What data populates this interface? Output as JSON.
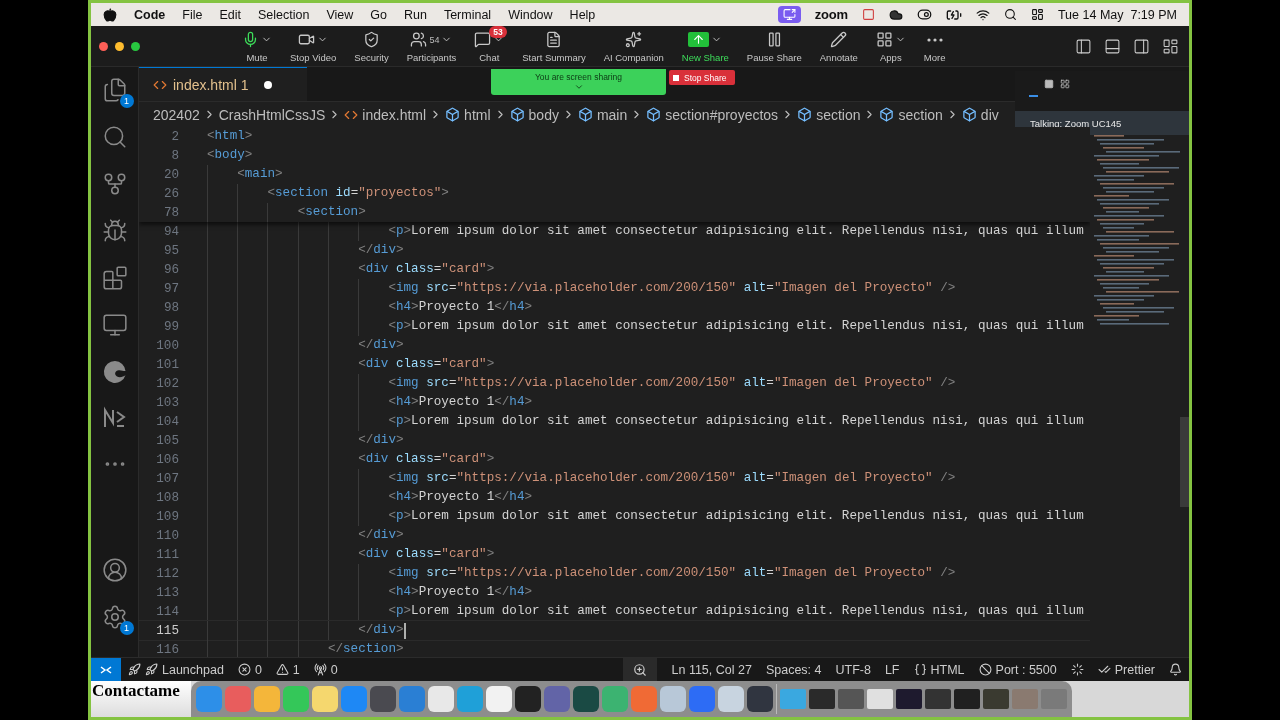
{
  "menu_bar": {
    "app": "Code",
    "items": [
      "File",
      "Edit",
      "Selection",
      "View",
      "Go",
      "Run",
      "Terminal",
      "Window",
      "Help"
    ],
    "app_label": "zoom",
    "datetime": "Tue 14 May  7:19 PM"
  },
  "zoom_toolbar": {
    "items": [
      {
        "kind": "mic",
        "label": "Mute",
        "caret": true,
        "active": true
      },
      {
        "kind": "video",
        "label": "Stop Video",
        "caret": true,
        "active": false
      },
      {
        "kind": "security",
        "label": "Security",
        "caret": false,
        "active": false
      },
      {
        "kind": "participants",
        "label": "Participants",
        "count": "54",
        "caret": true,
        "active": false
      },
      {
        "kind": "chat",
        "label": "Chat",
        "badge": "53",
        "caret": true,
        "active": false
      },
      {
        "kind": "summary",
        "label": "Start Summary",
        "caret": false,
        "active": false
      },
      {
        "kind": "companion",
        "label": "AI Companion",
        "caret": false,
        "active": false
      },
      {
        "kind": "share",
        "label": "New Share",
        "caret": true,
        "active": true
      },
      {
        "kind": "pause",
        "label": "Pause Share",
        "caret": false,
        "active": false
      },
      {
        "kind": "annotate",
        "label": "Annotate",
        "caret": false,
        "active": false
      },
      {
        "kind": "apps",
        "label": "Apps",
        "caret": true,
        "active": false
      },
      {
        "kind": "more",
        "label": "More",
        "caret": false,
        "active": false
      }
    ]
  },
  "sharing_banner": {
    "text": "You are screen sharing",
    "stop_button": "Stop Share"
  },
  "speaker_panel": {
    "text": "Talking: Zoom UC145"
  },
  "activity_bar": {
    "top": [
      {
        "kind": "explorer",
        "badge": "1"
      },
      {
        "kind": "search"
      },
      {
        "kind": "source-control"
      },
      {
        "kind": "debug"
      },
      {
        "kind": "extensions"
      },
      {
        "kind": "remote"
      },
      {
        "kind": "edge"
      },
      {
        "kind": "notebook"
      },
      {
        "kind": "more"
      }
    ],
    "bottom": [
      {
        "kind": "account"
      },
      {
        "kind": "settings",
        "badge": "1"
      }
    ]
  },
  "tab": {
    "label": "index.html 1",
    "modified": true
  },
  "breadcrumb": [
    {
      "kind": "folder",
      "label": "202402"
    },
    {
      "kind": "folder",
      "label": "CrashHtmlCssJS"
    },
    {
      "kind": "file",
      "label": "index.html"
    },
    {
      "kind": "element",
      "label": "html"
    },
    {
      "kind": "element",
      "label": "body"
    },
    {
      "kind": "element",
      "label": "main"
    },
    {
      "kind": "element",
      "label": "section#proyectos"
    },
    {
      "kind": "element",
      "label": "section"
    },
    {
      "kind": "element",
      "label": "section"
    },
    {
      "kind": "element",
      "label": "div"
    }
  ],
  "editor": {
    "sticky_lines": [
      {
        "number": "2",
        "text": "<html>"
      },
      {
        "number": "8",
        "text": "<body>"
      },
      {
        "number": "20",
        "text": "    <main>"
      },
      {
        "number": "26",
        "text": "        <section id=\"proyectos\">"
      },
      {
        "number": "78",
        "text": "            <section>"
      }
    ],
    "lines": [
      {
        "number": "94",
        "text": "                        <p>Lorem ipsum dolor sit amet consectetur adipisicing elit. Repellendus nisi, quas qui illum",
        "current": false
      },
      {
        "number": "95",
        "text": "                    </div>",
        "current": false
      },
      {
        "number": "96",
        "text": "                    <div class=\"card\">",
        "current": false
      },
      {
        "number": "97",
        "text": "                        <img src=\"https://via.placeholder.com/200/150\" alt=\"Imagen del Proyecto\" />",
        "current": false
      },
      {
        "number": "98",
        "text": "                        <h4>Proyecto 1</h4>",
        "current": false
      },
      {
        "number": "99",
        "text": "                        <p>Lorem ipsum dolor sit amet consectetur adipisicing elit. Repellendus nisi, quas qui illum",
        "current": false
      },
      {
        "number": "100",
        "text": "                    </div>",
        "current": false
      },
      {
        "number": "101",
        "text": "                    <div class=\"card\">",
        "current": false
      },
      {
        "number": "102",
        "text": "                        <img src=\"https://via.placeholder.com/200/150\" alt=\"Imagen del Proyecto\" />",
        "current": false
      },
      {
        "number": "103",
        "text": "                        <h4>Proyecto 1</h4>",
        "current": false
      },
      {
        "number": "104",
        "text": "                        <p>Lorem ipsum dolor sit amet consectetur adipisicing elit. Repellendus nisi, quas qui illum",
        "current": false
      },
      {
        "number": "105",
        "text": "                    </div>",
        "current": false
      },
      {
        "number": "106",
        "text": "                    <div class=\"card\">",
        "current": false
      },
      {
        "number": "107",
        "text": "                        <img src=\"https://via.placeholder.com/200/150\" alt=\"Imagen del Proyecto\" />",
        "current": false
      },
      {
        "number": "108",
        "text": "                        <h4>Proyecto 1</h4>",
        "current": false
      },
      {
        "number": "109",
        "text": "                        <p>Lorem ipsum dolor sit amet consectetur adipisicing elit. Repellendus nisi, quas qui illum",
        "current": false
      },
      {
        "number": "110",
        "text": "                    </div>",
        "current": false
      },
      {
        "number": "111",
        "text": "                    <div class=\"card\">",
        "current": false
      },
      {
        "number": "112",
        "text": "                        <img src=\"https://via.placeholder.com/200/150\" alt=\"Imagen del Proyecto\" />",
        "current": false
      },
      {
        "number": "113",
        "text": "                        <h4>Proyecto 1</h4>",
        "current": false
      },
      {
        "number": "114",
        "text": "                        <p>Lorem ipsum dolor sit amet consectetur adipisicing elit. Repellendus nisi, quas qui illum",
        "current": false
      },
      {
        "number": "115",
        "text": "                    </div>",
        "current": true
      },
      {
        "number": "116",
        "text": "                </section>",
        "current": false
      }
    ]
  },
  "status_bar": {
    "left": [
      {
        "kind": "remote"
      },
      {
        "kind": "launchpad",
        "label": "Launchpad"
      },
      {
        "kind": "errors",
        "label": "0"
      },
      {
        "kind": "warnings",
        "label": "1"
      },
      {
        "kind": "ports",
        "label": "0"
      }
    ],
    "right": [
      {
        "kind": "zoom"
      },
      {
        "kind": "text",
        "label": "Ln 115, Col 27"
      },
      {
        "kind": "text",
        "label": "Spaces: 4"
      },
      {
        "kind": "text",
        "label": "UTF-8"
      },
      {
        "kind": "text",
        "label": "LF"
      },
      {
        "kind": "language",
        "label": "HTML"
      },
      {
        "kind": "port",
        "label": "Port : 5500"
      },
      {
        "kind": "spinner"
      },
      {
        "kind": "prettier",
        "label": "Prettier"
      },
      {
        "kind": "bell"
      }
    ]
  },
  "dock": {
    "page_text": "Contactame",
    "apps": [
      {
        "color": "#2d8fe8"
      },
      {
        "color": "#e85d5d"
      },
      {
        "color": "#f4b63a"
      },
      {
        "color": "#34c759"
      },
      {
        "color": "#f5d76e"
      },
      {
        "color": "#1e88f5"
      },
      {
        "color": "#4a4a50"
      },
      {
        "color": "#2a7fd4"
      },
      {
        "color": "#e8e8e8"
      },
      {
        "color": "#1fa0d8"
      },
      {
        "color": "#f2f2f2"
      },
      {
        "color": "#222222"
      },
      {
        "color": "#6264a7"
      },
      {
        "color": "#1a4a44"
      },
      {
        "color": "#3cb371"
      },
      {
        "color": "#f06a35"
      },
      {
        "color": "#b8c8d8"
      },
      {
        "color": "#2d6cf5"
      },
      {
        "color": "#c8d4e0"
      },
      {
        "color": "#303540"
      }
    ],
    "windows": [
      {
        "color": "#3aa8e0"
      },
      {
        "color": "#2a2a2a"
      },
      {
        "color": "#555555"
      },
      {
        "color": "#e0e0e0"
      },
      {
        "color": "#1e1a2e"
      },
      {
        "color": "#333333"
      },
      {
        "color": "#202020"
      },
      {
        "color": "#3a3a30"
      },
      {
        "color": "#8a7a70"
      },
      {
        "color": "#7a7a7a"
      }
    ]
  }
}
